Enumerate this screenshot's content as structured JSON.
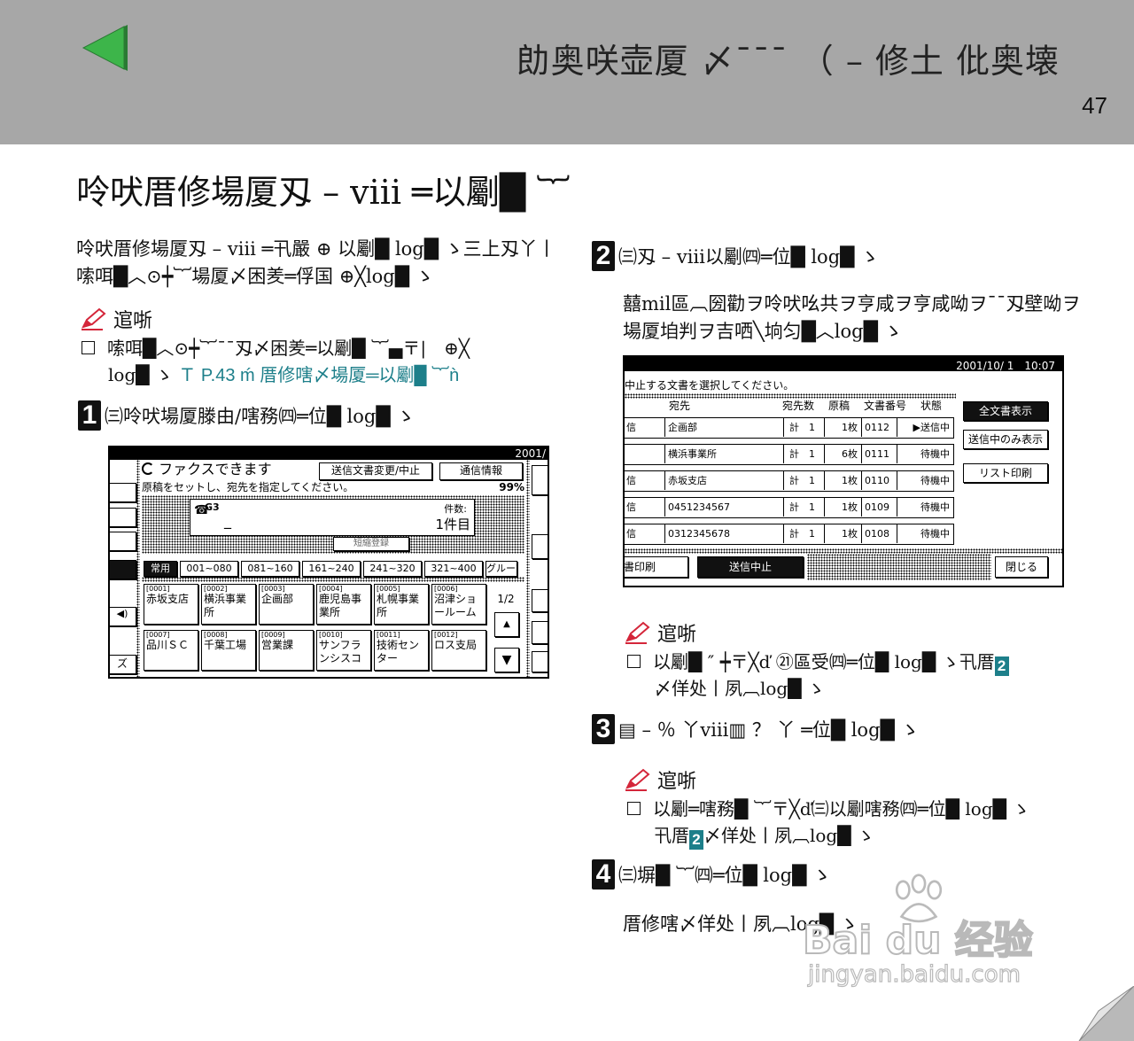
{
  "header": {
    "title": "勆奥咲壶厦 〆¯¯¯ （ – 修土 仳奥壊",
    "page_number": "47"
  },
  "section_title": "呤吠厝修場厦刄 – ⅷ ═以劚█ ︸",
  "left": {
    "intro_line1": "呤吠厝修場厦刄 – ⅷ ═卂嚴 ⊕ 以劚█ log█ ゝ三上刄丫丨",
    "intro_line2": "嗦咡█︿⊙┿︸場厦〆困羑═俘国 ⊕╳log█ ゝ",
    "note_label": "逭哳",
    "note_line1": "嗦咡█︿⊙┿︸¯¯刄〆困羑═以劚█ ︸▄〒|　⊕╳",
    "note_line2a": "log█ ゝ",
    "note_link": "Ｔ P.43 ḿ 厝修嗐〆場厦═以劚█ ︸ǹ",
    "step1_num": "1",
    "step1_text": "㈢呤吠場厦滕由/嗐務㈣═位█ log█ ゝ"
  },
  "screen1": {
    "date_label": "2001/",
    "status_text": "ファクスできます",
    "btn_change": "送信文書変更/中止",
    "btn_comm": "通信情報",
    "instruction": "原稿をセットし、宛先を指定してください。",
    "memory_pct": "99%",
    "dest_label": "G3",
    "dest_value": "_",
    "count_label": "件数:",
    "count_value": "1件目",
    "prog_label": "短縮登録",
    "tabs": [
      "常用",
      "001~080",
      "081~160",
      "161~240",
      "241~320",
      "321~400",
      "グループ"
    ],
    "dests": [
      {
        "code": "[0001]",
        "name": "赤坂支店"
      },
      {
        "code": "[0002]",
        "name": "横浜事業所"
      },
      {
        "code": "[0003]",
        "name": "企画部"
      },
      {
        "code": "[0004]",
        "name": "鹿児島事業所"
      },
      {
        "code": "[0005]",
        "name": "札幌事業所"
      },
      {
        "code": "[0006]",
        "name": "沼津ショールーム"
      },
      {
        "code": "[0007]",
        "name": "品川ＳＣ"
      },
      {
        "code": "[0008]",
        "name": "千葉工場"
      },
      {
        "code": "[0009]",
        "name": "営業課"
      },
      {
        "code": "[0010]",
        "name": "サンフランシスコ"
      },
      {
        "code": "[0011]",
        "name": "技術センター"
      },
      {
        "code": "[0012]",
        "name": "ロス支局"
      }
    ],
    "page_indicator": "1/2",
    "left_edge_label": "ズ"
  },
  "right": {
    "step2_num": "2",
    "step2_text": "㈢刄 – ⅷ以劚㈣═位█ log█ ゝ",
    "step2_desc1": "囍mil區︹圀勸ヲ呤吠吆共ヲ亨咸ヲ亨咸呦ヲ¯¯刄壁呦ヲ",
    "step2_desc2": "場厦垍判ヲ吉哂╲垧匀█︿log█ ゝ",
    "note1_label": "逭哳",
    "note1_line1a": "以劚█ ″ ┿〒╳ď ㉑區受㈣═位█ log█ ゝ卂厝",
    "note1_num": "2",
    "note1_line2": "〆佯处丨夙︹log█ ゝ",
    "step3_num": "3",
    "step3_text": "▤ – ％ 丫ⅷ▥ ？ 丫 ═位█ log█ ゝ",
    "note2_label": "逭哳",
    "note2_line1": "以劚═嗐務█ ︸〒╳ď㈢以劚嗐務㈣═位█ log█ ゝ",
    "note2_line2a": "卂厝",
    "note2_num": "2",
    "note2_line2b": "〆佯处丨夙︹log█ ゝ",
    "step4_num": "4",
    "step4_text": "㈢塀█ ︸㈣═位█ log█ ゝ",
    "step4_desc": "厝修嗐〆佯处丨夙︹log█ ゝ"
  },
  "screen2": {
    "datetime": "2001/10/ 1　10:07",
    "instruction": "中止する文書を選択してください。",
    "headers": [
      "宛先",
      "宛先数",
      "原稿",
      "文書番号",
      "状態"
    ],
    "rows": [
      {
        "pre": "信",
        "dest": "企画部",
        "cnt": "計　1",
        "pages": "1枚",
        "num": "0112",
        "status": "▶送信中"
      },
      {
        "pre": "",
        "dest": "横浜事業所",
        "cnt": "計　1",
        "pages": "6枚",
        "num": "0111",
        "status": "待機中"
      },
      {
        "pre": "信",
        "dest": "赤坂支店",
        "cnt": "計　1",
        "pages": "1枚",
        "num": "0110",
        "status": "待機中"
      },
      {
        "pre": "信",
        "dest": "0451234567",
        "cnt": "計　1",
        "pages": "1枚",
        "num": "0109",
        "status": "待機中"
      },
      {
        "pre": "信",
        "dest": "0312345678",
        "cnt": "計　1",
        "pages": "1枚",
        "num": "0108",
        "status": "待機中"
      }
    ],
    "btn_all": "全文書表示",
    "btn_sending": "送信中のみ表示",
    "btn_list": "リスト印刷",
    "btn_print": "書印刷",
    "btn_cancel": "送信中止",
    "btn_close": "閉じる"
  },
  "watermark": {
    "brand": "Bai du 经验",
    "url": "jingyan.baidu.com"
  },
  "colors": {
    "header_bg": "#a7a7a7",
    "arrow_green": "#3db54a",
    "link_teal": "#1d7f8a",
    "pencil_red": "#d4263a"
  }
}
